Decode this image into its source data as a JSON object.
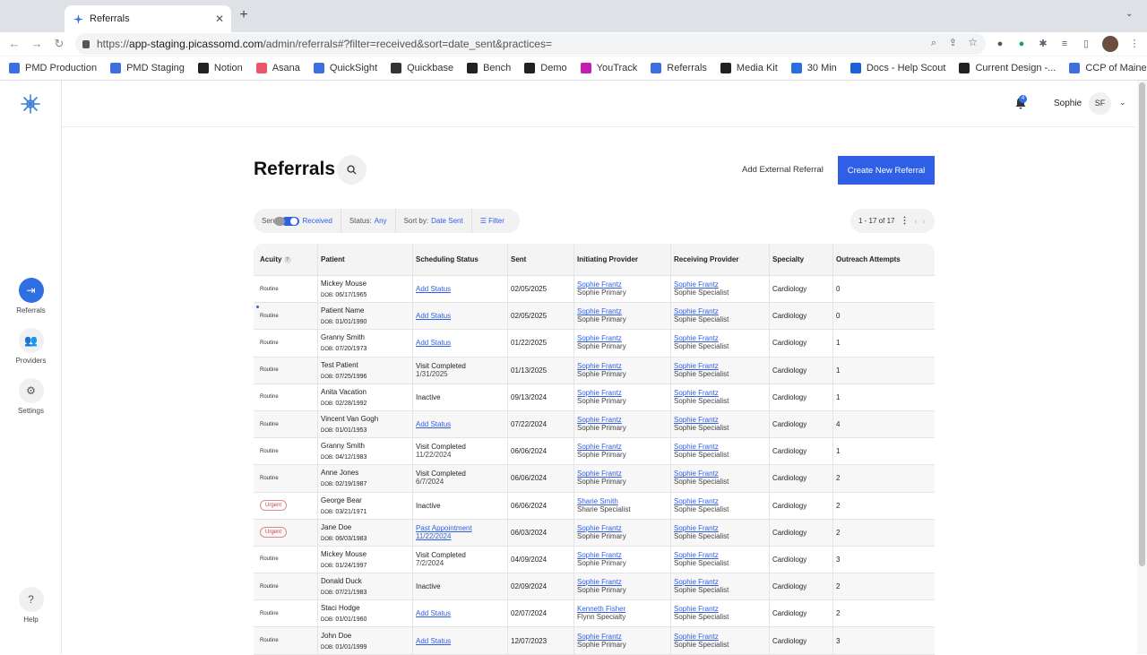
{
  "browser": {
    "tab_title": "Referrals",
    "url_prefix": "https://",
    "url_host": "app-staging.picassomd.com",
    "url_path": "/admin/referrals#?filter=received&sort=date_sent&practices=",
    "bookmarks": [
      {
        "label": "PMD Production",
        "color": "#3d6fe0"
      },
      {
        "label": "PMD Staging",
        "color": "#3d6fe0"
      },
      {
        "label": "Notion",
        "color": "#222"
      },
      {
        "label": "Asana",
        "color": "#e8586a"
      },
      {
        "label": "QuickSight",
        "color": "#3d6fe0"
      },
      {
        "label": "Quickbase",
        "color": "#333"
      },
      {
        "label": "Bench",
        "color": "#222"
      },
      {
        "label": "Demo",
        "color": "#222"
      },
      {
        "label": "YouTrack",
        "color": "#c21fb0"
      },
      {
        "label": "Referrals",
        "color": "#3d6fe0"
      },
      {
        "label": "Media Kit",
        "color": "#222"
      },
      {
        "label": "30 Min",
        "color": "#2a6ee0"
      },
      {
        "label": "Docs - Help Scout",
        "color": "#1d5fd6"
      },
      {
        "label": "Current Design -...",
        "color": "#222"
      },
      {
        "label": "CCP of Maine Das...",
        "color": "#3d6fe0"
      }
    ]
  },
  "sidebar": {
    "items": [
      {
        "label": "Referrals",
        "icon": "referrals-icon"
      },
      {
        "label": "Providers",
        "icon": "providers-icon"
      },
      {
        "label": "Settings",
        "icon": "gear-icon"
      },
      {
        "label": "Help",
        "icon": "help-icon"
      }
    ]
  },
  "header": {
    "notification_count": "4",
    "user_name": "Sophie",
    "user_initials": "SF"
  },
  "page": {
    "title": "Referrals",
    "add_external_label": "Add External Referral",
    "create_label": "Create New Referral"
  },
  "filters": {
    "sent_label": "Sent",
    "received_label": "Received",
    "status_label": "Status:",
    "status_value": "Any",
    "sort_label": "Sort by:",
    "sort_value": "Date Sent",
    "filter_label": "Filter"
  },
  "pager": {
    "text": "1 - 17 of 17"
  },
  "table": {
    "columns": [
      "Acuity",
      "Patient",
      "Scheduling Status",
      "Sent",
      "Initiating Provider",
      "Receiving Provider",
      "Specialty",
      "Outreach Attempts"
    ],
    "rows": [
      {
        "acuity": "Routine",
        "patient": "Mickey Mouse",
        "dob": "06/17/1965",
        "status": "Add Status",
        "status_link": true,
        "status_sub": "",
        "sent": "02/05/2025",
        "init_name": "Sophie Frantz",
        "init_sub": "Sophie Primary",
        "recv_name": "Sophie Frantz",
        "recv_sub": "Sophie Specialist",
        "specialty": "Cardiology",
        "attempts": "0"
      },
      {
        "acuity": "Routine",
        "patient": "Patient Name",
        "dob": "01/01/1990",
        "status": "Add Status",
        "status_link": true,
        "status_sub": "",
        "sent": "02/05/2025",
        "init_name": "Sophie Frantz",
        "init_sub": "Sophie Primary",
        "recv_name": "Sophie Frantz",
        "recv_sub": "Sophie Specialist",
        "specialty": "Cardiology",
        "attempts": "0"
      },
      {
        "acuity": "Routine",
        "patient": "Granny Smith",
        "dob": "07/20/1973",
        "status": "Add Status",
        "status_link": true,
        "status_sub": "",
        "sent": "01/22/2025",
        "init_name": "Sophie Frantz",
        "init_sub": "Sophie Primary",
        "recv_name": "Sophie Frantz",
        "recv_sub": "Sophie Specialist",
        "specialty": "Cardiology",
        "attempts": "1"
      },
      {
        "acuity": "Routine",
        "patient": "Test Patient",
        "dob": "07/25/1996",
        "status": "Visit Completed",
        "status_link": false,
        "status_sub": "1/31/2025",
        "sent": "01/13/2025",
        "init_name": "Sophie Frantz",
        "init_sub": "Sophie Primary",
        "recv_name": "Sophie Frantz",
        "recv_sub": "Sophie Specialist",
        "specialty": "Cardiology",
        "attempts": "1"
      },
      {
        "acuity": "Routine",
        "patient": "Anita Vacation",
        "dob": "02/28/1992",
        "status": "Inactive",
        "status_link": false,
        "status_sub": "",
        "sent": "09/13/2024",
        "init_name": "Sophie Frantz",
        "init_sub": "Sophie Primary",
        "recv_name": "Sophie Frantz",
        "recv_sub": "Sophie Specialist",
        "specialty": "Cardiology",
        "attempts": "1"
      },
      {
        "acuity": "Routine",
        "patient": "Vincent Van Gogh",
        "dob": "01/01/1953",
        "status": "Add Status",
        "status_link": true,
        "status_sub": "",
        "sent": "07/22/2024",
        "init_name": "Sophie Frantz",
        "init_sub": "Sophie Primary",
        "recv_name": "Sophie Frantz",
        "recv_sub": "Sophie Specialist",
        "specialty": "Cardiology",
        "attempts": "4"
      },
      {
        "acuity": "Routine",
        "patient": "Granny Smith",
        "dob": "04/12/1983",
        "status": "Visit Completed",
        "status_link": false,
        "status_sub": "11/22/2024",
        "sent": "06/06/2024",
        "init_name": "Sophie Frantz",
        "init_sub": "Sophie Primary",
        "recv_name": "Sophie Frantz",
        "recv_sub": "Sophie Specialist",
        "specialty": "Cardiology",
        "attempts": "1"
      },
      {
        "acuity": "Routine",
        "patient": "Anne Jones",
        "dob": "02/19/1987",
        "status": "Visit Completed",
        "status_link": false,
        "status_sub": "6/7/2024",
        "sent": "06/06/2024",
        "init_name": "Sophie Frantz",
        "init_sub": "Sophie Primary",
        "recv_name": "Sophie Frantz",
        "recv_sub": "Sophie Specialist",
        "specialty": "Cardiology",
        "attempts": "2"
      },
      {
        "acuity": "Urgent",
        "patient": "George Bear",
        "dob": "03/21/1971",
        "status": "Inactive",
        "status_link": false,
        "status_sub": "",
        "sent": "06/06/2024",
        "init_name": "Sharie Smith",
        "init_sub": "Sharie Specialist",
        "recv_name": "Sophie Frantz",
        "recv_sub": "Sophie Specialist",
        "specialty": "Cardiology",
        "attempts": "2"
      },
      {
        "acuity": "Urgent",
        "patient": "Jane Doe",
        "dob": "06/03/1983",
        "status": "Past Appointment",
        "status_link": true,
        "status_sub": "11/22/2024",
        "sent": "06/03/2024",
        "init_name": "Sophie Frantz",
        "init_sub": "Sophie Primary",
        "recv_name": "Sophie Frantz",
        "recv_sub": "Sophie Specialist",
        "specialty": "Cardiology",
        "attempts": "2"
      },
      {
        "acuity": "Routine",
        "patient": "Mickey Mouse",
        "dob": "01/24/1997",
        "status": "Visit Completed",
        "status_link": false,
        "status_sub": "7/2/2024",
        "sent": "04/09/2024",
        "init_name": "Sophie Frantz",
        "init_sub": "Sophie Primary",
        "recv_name": "Sophie Frantz",
        "recv_sub": "Sophie Specialist",
        "specialty": "Cardiology",
        "attempts": "3"
      },
      {
        "acuity": "Routine",
        "patient": "Donald Duck",
        "dob": "07/21/1983",
        "status": "Inactive",
        "status_link": false,
        "status_sub": "",
        "sent": "02/09/2024",
        "init_name": "Sophie Frantz",
        "init_sub": "Sophie Primary",
        "recv_name": "Sophie Frantz",
        "recv_sub": "Sophie Specialist",
        "specialty": "Cardiology",
        "attempts": "2"
      },
      {
        "acuity": "Routine",
        "patient": "Staci Hodge",
        "dob": "01/01/1960",
        "status": "Add Status",
        "status_link": true,
        "status_sub": "",
        "sent": "02/07/2024",
        "init_name": "Kenneth Fisher",
        "init_sub": "Flynn Specialty",
        "recv_name": "Sophie Frantz",
        "recv_sub": "Sophie Specialist",
        "specialty": "Cardiology",
        "attempts": "2"
      },
      {
        "acuity": "Routine",
        "patient": "John Doe",
        "dob": "01/01/1999",
        "status": "Add Status",
        "status_link": true,
        "status_sub": "",
        "sent": "12/07/2023",
        "init_name": "Sophie Frantz",
        "init_sub": "Sophie Primary",
        "recv_name": "Sophie Frantz",
        "recv_sub": "Sophie Specialist",
        "specialty": "Cardiology",
        "attempts": "3"
      }
    ]
  },
  "colors": {
    "accent": "#2f5fe6",
    "urgent": "#c44444"
  }
}
